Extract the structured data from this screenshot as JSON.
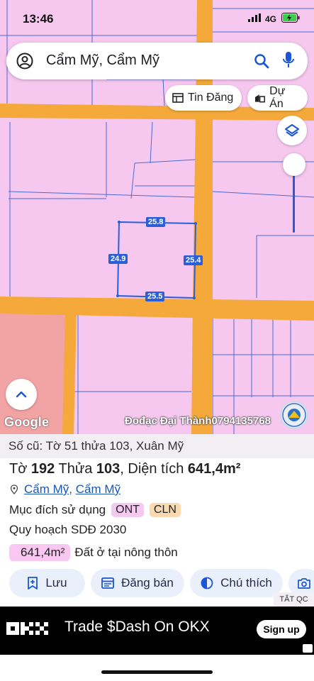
{
  "status_bar": {
    "time": "13:46",
    "network": "4G"
  },
  "search": {
    "query": "Cẩm Mỹ, Cẩm Mỹ"
  },
  "chips": {
    "tin_dang": "Tin Đăng",
    "du_an": "Dự Án"
  },
  "map": {
    "dimensions": {
      "top": "25.8",
      "left": "24.9",
      "right": "25.4",
      "bottom": "25.5"
    },
    "google_logo": "Google",
    "watermark": "Đođạc Đại Thành0794135768",
    "colors": {
      "land": "#f7c8ef",
      "road": "#f4a93a",
      "red_zone": "#f2a3a3",
      "boundary": "#2a5fd8"
    }
  },
  "sheet": {
    "old_ref": "Số cũ: Tờ 51 thửa 103, Xuân Mỹ",
    "to_label": "Tờ",
    "to_value": "192",
    "thua_label": "Thửa",
    "thua_value": "103",
    "area_label": ", Diện tích",
    "area_value": "641,4m²",
    "loc1": "Cẩm Mỹ",
    "loc_sep": ", ",
    "loc2": "Cẩm Mỹ",
    "purpose_label": "Mục đích sử dụng",
    "tag1": "ONT",
    "tag2": "CLN",
    "plan": "Quy hoạch SDĐ 2030",
    "area_badge": "641,4m²",
    "area_desc": "Đất ở tại nông thôn"
  },
  "actions": {
    "save": "Lưu",
    "sell": "Đăng bán",
    "note": "Chú thích"
  },
  "ad": {
    "label": "TẮT QC",
    "logo": "OKX",
    "text": "Trade $Dash On OKX",
    "signup": "Sign up"
  }
}
